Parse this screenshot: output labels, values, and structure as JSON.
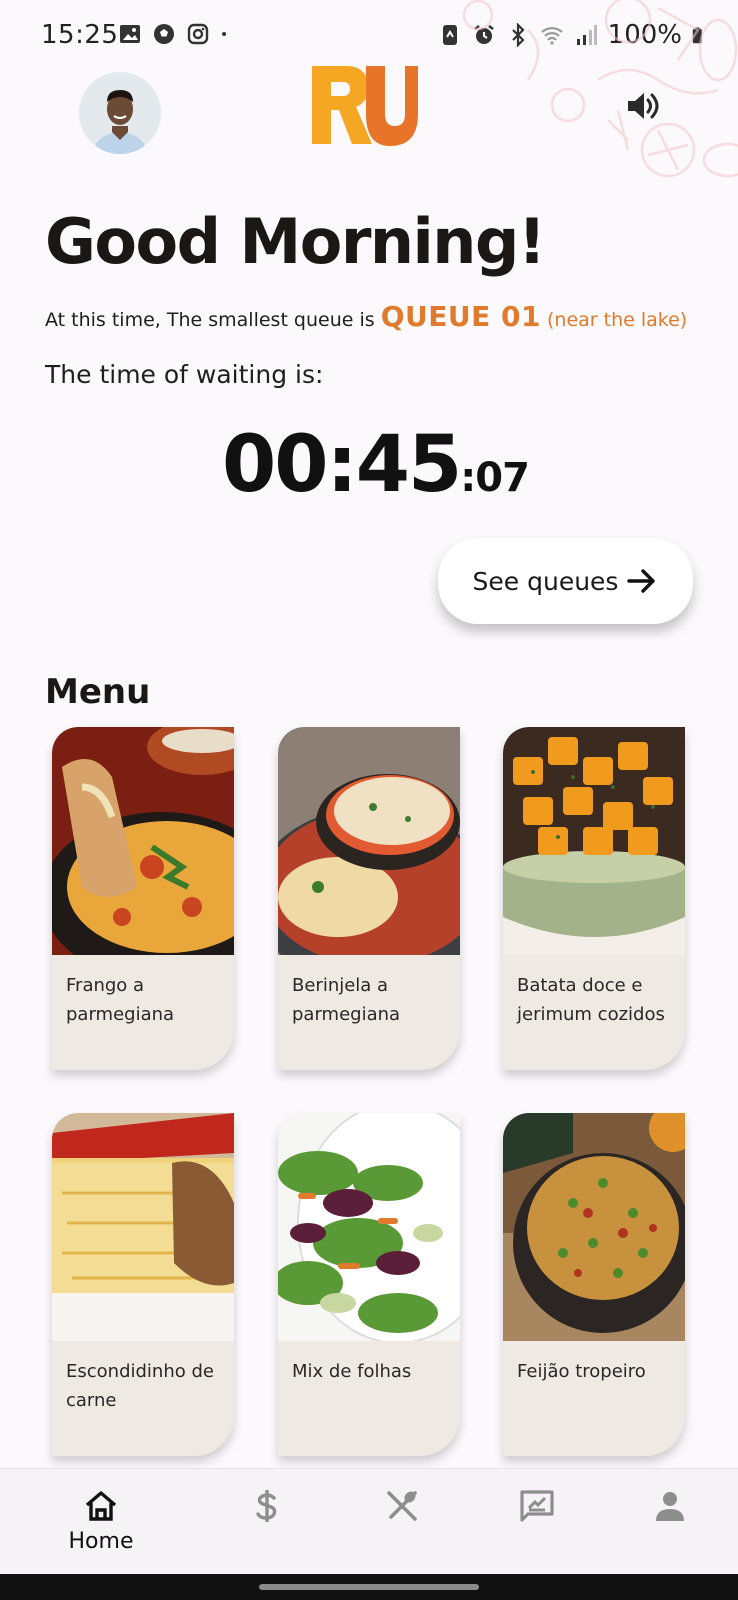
{
  "status_bar": {
    "time": "15:25",
    "battery": "100%",
    "left_icons": [
      "image-icon",
      "soccer-ball-icon",
      "instagram-icon",
      "dot-icon"
    ],
    "right_icons": [
      "sync-icon",
      "alarm-icon",
      "bluetooth-icon",
      "wifi-icon",
      "signal-icon",
      "battery-icon"
    ]
  },
  "header": {
    "logo_text": "RU",
    "logo_colors": [
      "#f5a623",
      "#e8742a"
    ],
    "sound_icon": "volume-icon"
  },
  "greeting": {
    "title": "Good Morning!",
    "queue_prefix": "At this time, The smallest queue is",
    "queue_name": "QUEUE 01",
    "queue_location": "(near the lake)",
    "wait_label": "The time of waiting is:",
    "timer_main": "00:45",
    "timer_seconds": ":07",
    "accent_color": "#e07a2c"
  },
  "see_queues": {
    "label": "See queues",
    "icon": "arrow-right-icon"
  },
  "menu": {
    "title": "Menu",
    "items": [
      {
        "label": "Frango a parmegiana"
      },
      {
        "label": "Berinjela a parmegiana"
      },
      {
        "label": "Batata doce e jerimum cozidos"
      },
      {
        "label": "Escondidinho de carne"
      },
      {
        "label": "Mix de folhas"
      },
      {
        "label": "Feijão tropeiro"
      }
    ]
  },
  "bottom_nav": {
    "items": [
      {
        "label": "Home",
        "icon": "home-icon"
      },
      {
        "label": "",
        "icon": "dollar-icon"
      },
      {
        "label": "",
        "icon": "cutlery-icon"
      },
      {
        "label": "",
        "icon": "feedback-icon"
      },
      {
        "label": "",
        "icon": "profile-icon"
      }
    ]
  }
}
